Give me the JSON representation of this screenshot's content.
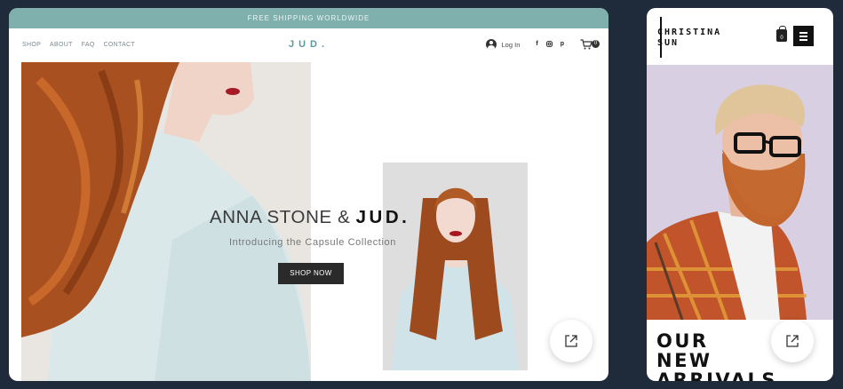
{
  "desktop": {
    "promo_bar": "FREE SHIPPING WORLDWIDE",
    "nav": [
      {
        "label": "SHOP"
      },
      {
        "label": "ABOUT"
      },
      {
        "label": "FAQ"
      },
      {
        "label": "CONTACT"
      }
    ],
    "brand": "JUD.",
    "login_label": "Log In",
    "social_icons": [
      "facebook-icon",
      "instagram-icon",
      "pinterest-icon"
    ],
    "cart_count": "0",
    "hero": {
      "title_prefix": "ANNA STONE & ",
      "title_brand": "JUD.",
      "subtitle": "Introducing the Capsule Collection",
      "cta": "SHOP NOW"
    },
    "accent_color": "#7fb0ad"
  },
  "mobile": {
    "logo_line1": "CHRISTINA",
    "logo_line2": "SUN",
    "bag_count": "0",
    "headline_line1": "OUR NEW",
    "headline_line2": "ARRIVALS",
    "hero_bg": "#d8d0e2"
  },
  "page_bg": "#1f2a3b"
}
